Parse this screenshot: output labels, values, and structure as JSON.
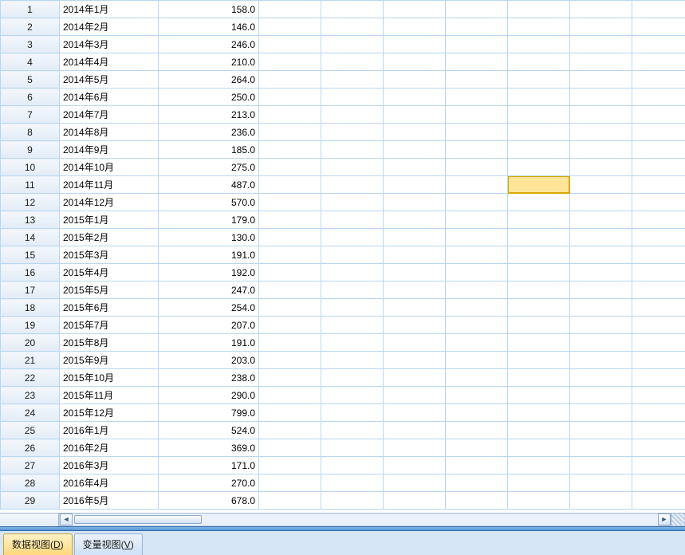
{
  "selected_cell": {
    "row": 11,
    "col": 7
  },
  "rows": [
    {
      "n": 1,
      "date": "2014年1月",
      "value": "158.0"
    },
    {
      "n": 2,
      "date": "2014年2月",
      "value": "146.0"
    },
    {
      "n": 3,
      "date": "2014年3月",
      "value": "246.0"
    },
    {
      "n": 4,
      "date": "2014年4月",
      "value": "210.0"
    },
    {
      "n": 5,
      "date": "2014年5月",
      "value": "264.0"
    },
    {
      "n": 6,
      "date": "2014年6月",
      "value": "250.0"
    },
    {
      "n": 7,
      "date": "2014年7月",
      "value": "213.0"
    },
    {
      "n": 8,
      "date": "2014年8月",
      "value": "236.0"
    },
    {
      "n": 9,
      "date": "2014年9月",
      "value": "185.0"
    },
    {
      "n": 10,
      "date": "2014年10月",
      "value": "275.0"
    },
    {
      "n": 11,
      "date": "2014年11月",
      "value": "487.0"
    },
    {
      "n": 12,
      "date": "2014年12月",
      "value": "570.0"
    },
    {
      "n": 13,
      "date": "2015年1月",
      "value": "179.0"
    },
    {
      "n": 14,
      "date": "2015年2月",
      "value": "130.0"
    },
    {
      "n": 15,
      "date": "2015年3月",
      "value": "191.0"
    },
    {
      "n": 16,
      "date": "2015年4月",
      "value": "192.0"
    },
    {
      "n": 17,
      "date": "2015年5月",
      "value": "247.0"
    },
    {
      "n": 18,
      "date": "2015年6月",
      "value": "254.0"
    },
    {
      "n": 19,
      "date": "2015年7月",
      "value": "207.0"
    },
    {
      "n": 20,
      "date": "2015年8月",
      "value": "191.0"
    },
    {
      "n": 21,
      "date": "2015年9月",
      "value": "203.0"
    },
    {
      "n": 22,
      "date": "2015年10月",
      "value": "238.0"
    },
    {
      "n": 23,
      "date": "2015年11月",
      "value": "290.0"
    },
    {
      "n": 24,
      "date": "2015年12月",
      "value": "799.0"
    },
    {
      "n": 25,
      "date": "2016年1月",
      "value": "524.0"
    },
    {
      "n": 26,
      "date": "2016年2月",
      "value": "369.0"
    },
    {
      "n": 27,
      "date": "2016年3月",
      "value": "171.0"
    },
    {
      "n": 28,
      "date": "2016年4月",
      "value": "270.0"
    },
    {
      "n": 29,
      "date": "2016年5月",
      "value": "678.0"
    }
  ],
  "blank_col_count": 8,
  "tabs": {
    "data_view": {
      "text": "数据视图(",
      "accel": "D",
      "suffix": ")"
    },
    "variable_view": {
      "text": "变量视图(",
      "accel": "V",
      "suffix": ")"
    }
  }
}
